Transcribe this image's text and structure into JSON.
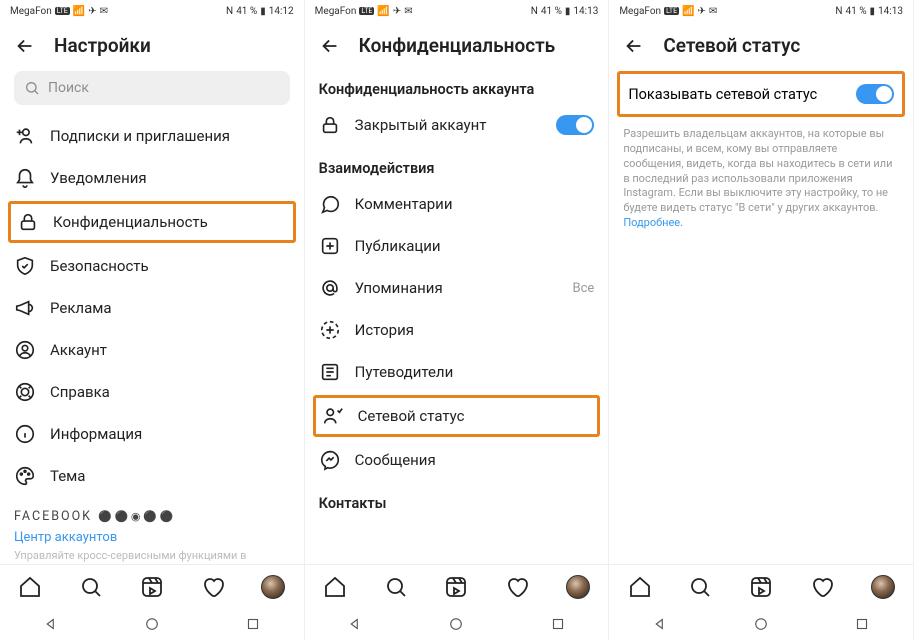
{
  "status": {
    "carrier": "MegaFon",
    "nfc": "N",
    "battery": "41 %",
    "time1": "14:12",
    "time2": "14:13",
    "time3": "14:13"
  },
  "screen1": {
    "title": "Настройки",
    "search_placeholder": "Поиск",
    "items": {
      "subs": "Подписки и приглашения",
      "notif": "Уведомления",
      "privacy": "Конфиденциальность",
      "security": "Безопасность",
      "ads": "Реклама",
      "account": "Аккаунт",
      "help": "Справка",
      "info": "Информация",
      "theme": "Тема"
    },
    "brand": "FACEBOOK",
    "center": "Центр аккаунтов",
    "hint": "Управляйте кросс-сервисными функциями в"
  },
  "screen2": {
    "title": "Конфиденциальность",
    "section_account": "Конфиденциальность аккаунта",
    "private": "Закрытый аккаунт",
    "section_inter": "Взаимодействия",
    "items": {
      "comments": "Комментарии",
      "posts": "Публикации",
      "mentions": "Упоминания",
      "mentions_trail": "Все",
      "story": "История",
      "guides": "Путеводители",
      "activity": "Сетевой статус",
      "messages": "Сообщения"
    },
    "section_contacts": "Контакты"
  },
  "screen3": {
    "title": "Сетевой статус",
    "toggle_label": "Показывать сетевой статус",
    "desc": "Разрешить владельцам аккаунтов, на которые вы подписаны, и всем, кому вы отправляете сообщения, видеть, когда вы находитесь в сети или в последний раз использовали приложения Instagram. Если вы выключите эту настройку, то не будете видеть статус \"В сети\" у других аккаунтов. ",
    "more": "Подробнее."
  }
}
